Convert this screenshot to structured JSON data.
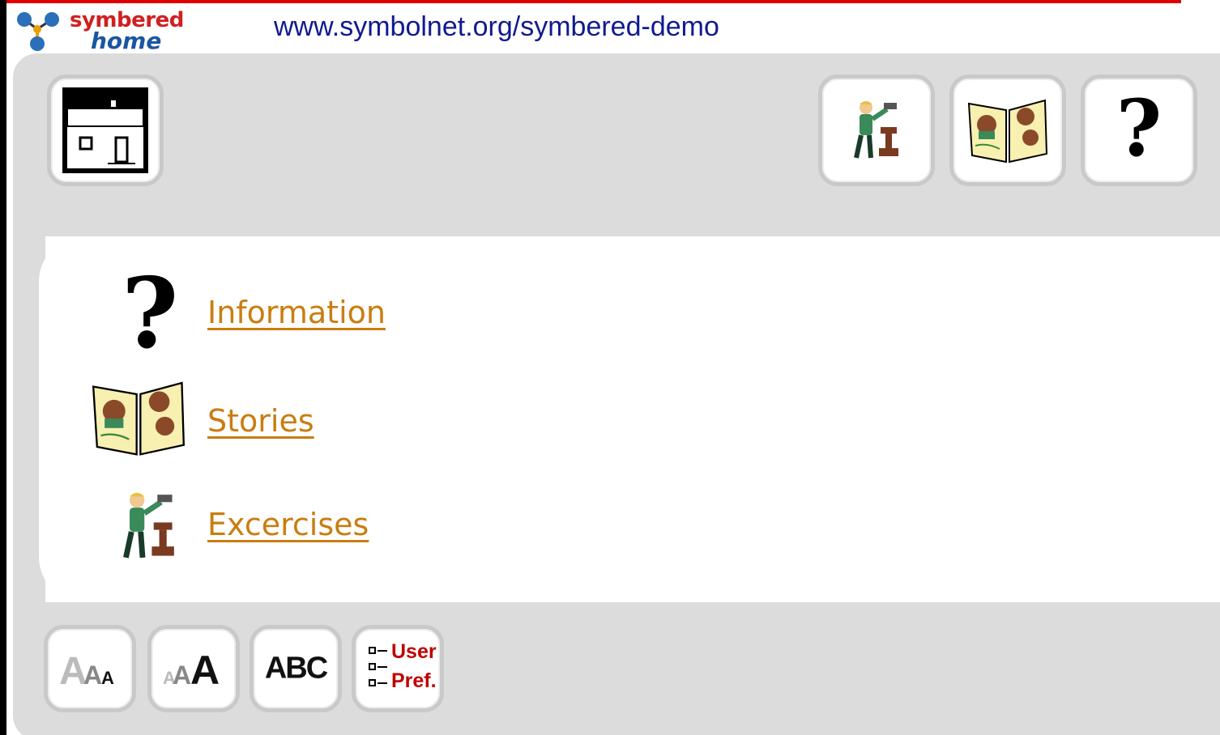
{
  "header": {
    "logo_line1": "symbered",
    "logo_line2": "home",
    "url": "www.symbolnet.org/symbered-demo"
  },
  "toolbar_top": {
    "home_icon": "home-icon",
    "right_buttons": [
      "exercises-icon",
      "stories-icon",
      "question-mark-icon"
    ]
  },
  "menu": {
    "items": [
      {
        "label": "Information",
        "icon": "question-mark-icon"
      },
      {
        "label": "Stories",
        "icon": "open-book-icon"
      },
      {
        "label": "Excercises",
        "icon": "person-hammering-icon"
      }
    ]
  },
  "toolbar_bottom": {
    "abc_label": "ABC",
    "user_pref_line1": "User",
    "user_pref_line2": "Pref."
  },
  "colors": {
    "link": "#c97d10",
    "url": "#101a90",
    "panel": "#dcdcdc",
    "accent_red": "#e00000"
  }
}
